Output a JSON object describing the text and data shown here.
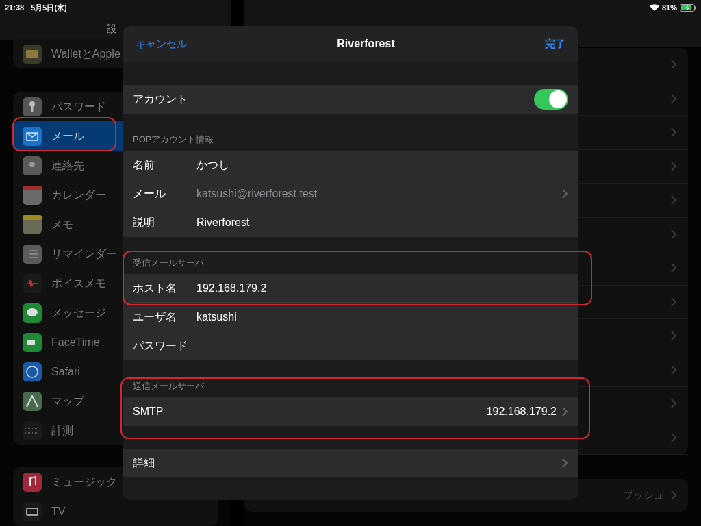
{
  "status_bar": {
    "time": "21:38",
    "date": "5月5日(水)",
    "battery": "81%"
  },
  "sidebar": {
    "title": "設",
    "groups": [
      [
        {
          "label": "WalletとApple",
          "selected": false
        }
      ],
      [
        {
          "label": "パスワード",
          "selected": false
        },
        {
          "label": "メール",
          "selected": true
        },
        {
          "label": "連絡先",
          "selected": false
        },
        {
          "label": "カレンダー",
          "selected": false
        },
        {
          "label": "メモ",
          "selected": false
        },
        {
          "label": "リマインダー",
          "selected": false
        },
        {
          "label": "ボイスメモ",
          "selected": false
        },
        {
          "label": "メッセージ",
          "selected": false
        },
        {
          "label": "FaceTime",
          "selected": false
        },
        {
          "label": "Safari",
          "selected": false
        },
        {
          "label": "マップ",
          "selected": false
        },
        {
          "label": "計測",
          "selected": false
        }
      ],
      [
        {
          "label": "ミュージック",
          "selected": false
        },
        {
          "label": "TV",
          "selected": false
        }
      ]
    ]
  },
  "detail": {
    "push_value": "プッシュ"
  },
  "sheet": {
    "cancel": "キャンセル",
    "title": "Riverforest",
    "done": "完了",
    "account": {
      "label": "アカウント",
      "on": true
    },
    "sections": [
      {
        "header": "POPアカウント情報",
        "rows": [
          {
            "label": "名前",
            "value": "かつし",
            "dim": false,
            "chevron": false
          },
          {
            "label": "メール",
            "value": "katsushi@riverforest.test",
            "dim": true,
            "chevron": true
          },
          {
            "label": "説明",
            "value": "Riverforest",
            "dim": false,
            "chevron": false
          }
        ]
      },
      {
        "header": "受信メールサーバ",
        "rows": [
          {
            "label": "ホスト名",
            "value": "192.168.179.2",
            "dim": false,
            "chevron": false
          },
          {
            "label": "ユーザ名",
            "value": "katsushi",
            "dim": false,
            "chevron": false
          },
          {
            "label": "パスワード",
            "chevron": false
          }
        ]
      },
      {
        "header": "送信メールサーバ",
        "rows": [
          {
            "label": "SMTP",
            "value": "192.168.179.2",
            "dim": false,
            "chevron": true
          }
        ]
      }
    ],
    "advanced": {
      "label": "詳細"
    }
  }
}
